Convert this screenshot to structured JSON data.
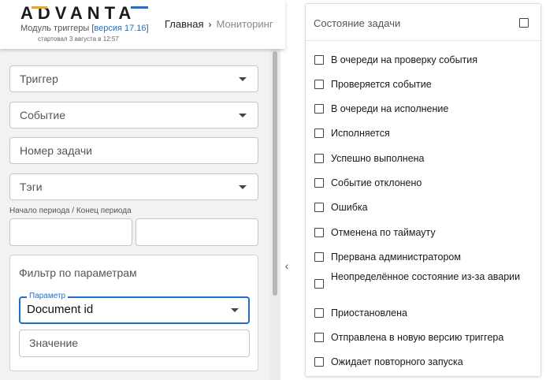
{
  "header": {
    "logo_text": "ADVANTA",
    "subtitle_prefix": "Модуль триггеры [",
    "version": "версия 17.16",
    "subtitle_suffix": "]",
    "started": "стартовал 3 августа в 12:57",
    "breadcrumb": {
      "home": "Главная",
      "separator": "›",
      "current": "Мониторинг"
    }
  },
  "colors": {
    "accent": "#1e6fd0",
    "logo_orange": "#f2a31b",
    "logo_blue": "#1e6fd0"
  },
  "filters": {
    "trigger_placeholder": "Триггер",
    "event_placeholder": "Событие",
    "task_number_placeholder": "Номер задачи",
    "tags_placeholder": "Тэги",
    "period_label": "Начало периода / Конец периода",
    "param_filter": {
      "title": "Фильтр по параметрам",
      "param_label": "Параметр",
      "param_value": "Document id",
      "value_placeholder": "Значение"
    }
  },
  "collapse_icon": "‹",
  "status_panel": {
    "title": "Состояние задачи",
    "items": [
      {
        "label": "В очереди на проверку события"
      },
      {
        "label": "Проверяется событие"
      },
      {
        "label": "В очереди на исполнение"
      },
      {
        "label": "Исполняется"
      },
      {
        "label": "Успешно выполнена"
      },
      {
        "label": "Событие отклонено"
      },
      {
        "label": "Ошибка"
      },
      {
        "label": "Отменена по таймауту"
      },
      {
        "label": "Прервана администратором"
      },
      {
        "label": "Неопределённое состояние из-за аварии"
      },
      {
        "label": "Приостановлена"
      },
      {
        "label": "Отправлена в новую версию триггера"
      },
      {
        "label": "Ожидает повторного запуска"
      }
    ]
  }
}
